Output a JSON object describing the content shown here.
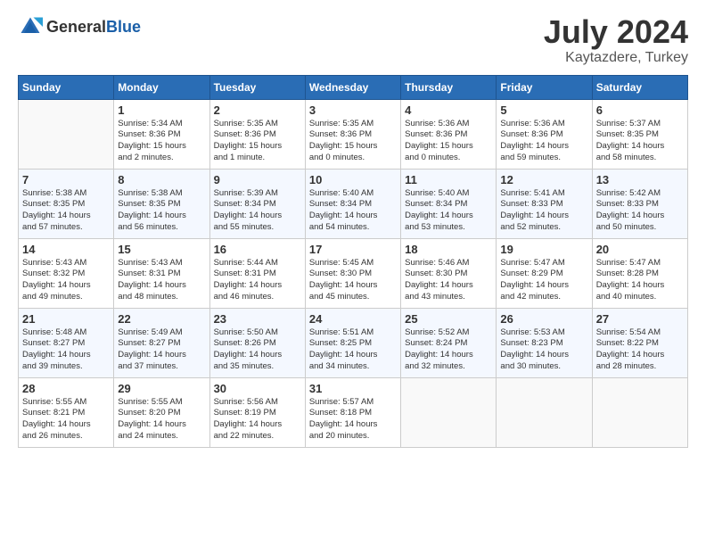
{
  "header": {
    "logo_general": "General",
    "logo_blue": "Blue",
    "month": "July 2024",
    "location": "Kaytazdere, Turkey"
  },
  "days_of_week": [
    "Sunday",
    "Monday",
    "Tuesday",
    "Wednesday",
    "Thursday",
    "Friday",
    "Saturday"
  ],
  "weeks": [
    [
      {
        "day": "",
        "info": ""
      },
      {
        "day": "1",
        "info": "Sunrise: 5:34 AM\nSunset: 8:36 PM\nDaylight: 15 hours\nand 2 minutes."
      },
      {
        "day": "2",
        "info": "Sunrise: 5:35 AM\nSunset: 8:36 PM\nDaylight: 15 hours\nand 1 minute."
      },
      {
        "day": "3",
        "info": "Sunrise: 5:35 AM\nSunset: 8:36 PM\nDaylight: 15 hours\nand 0 minutes."
      },
      {
        "day": "4",
        "info": "Sunrise: 5:36 AM\nSunset: 8:36 PM\nDaylight: 15 hours\nand 0 minutes."
      },
      {
        "day": "5",
        "info": "Sunrise: 5:36 AM\nSunset: 8:36 PM\nDaylight: 14 hours\nand 59 minutes."
      },
      {
        "day": "6",
        "info": "Sunrise: 5:37 AM\nSunset: 8:35 PM\nDaylight: 14 hours\nand 58 minutes."
      }
    ],
    [
      {
        "day": "7",
        "info": "Sunrise: 5:38 AM\nSunset: 8:35 PM\nDaylight: 14 hours\nand 57 minutes."
      },
      {
        "day": "8",
        "info": "Sunrise: 5:38 AM\nSunset: 8:35 PM\nDaylight: 14 hours\nand 56 minutes."
      },
      {
        "day": "9",
        "info": "Sunrise: 5:39 AM\nSunset: 8:34 PM\nDaylight: 14 hours\nand 55 minutes."
      },
      {
        "day": "10",
        "info": "Sunrise: 5:40 AM\nSunset: 8:34 PM\nDaylight: 14 hours\nand 54 minutes."
      },
      {
        "day": "11",
        "info": "Sunrise: 5:40 AM\nSunset: 8:34 PM\nDaylight: 14 hours\nand 53 minutes."
      },
      {
        "day": "12",
        "info": "Sunrise: 5:41 AM\nSunset: 8:33 PM\nDaylight: 14 hours\nand 52 minutes."
      },
      {
        "day": "13",
        "info": "Sunrise: 5:42 AM\nSunset: 8:33 PM\nDaylight: 14 hours\nand 50 minutes."
      }
    ],
    [
      {
        "day": "14",
        "info": "Sunrise: 5:43 AM\nSunset: 8:32 PM\nDaylight: 14 hours\nand 49 minutes."
      },
      {
        "day": "15",
        "info": "Sunrise: 5:43 AM\nSunset: 8:31 PM\nDaylight: 14 hours\nand 48 minutes."
      },
      {
        "day": "16",
        "info": "Sunrise: 5:44 AM\nSunset: 8:31 PM\nDaylight: 14 hours\nand 46 minutes."
      },
      {
        "day": "17",
        "info": "Sunrise: 5:45 AM\nSunset: 8:30 PM\nDaylight: 14 hours\nand 45 minutes."
      },
      {
        "day": "18",
        "info": "Sunrise: 5:46 AM\nSunset: 8:30 PM\nDaylight: 14 hours\nand 43 minutes."
      },
      {
        "day": "19",
        "info": "Sunrise: 5:47 AM\nSunset: 8:29 PM\nDaylight: 14 hours\nand 42 minutes."
      },
      {
        "day": "20",
        "info": "Sunrise: 5:47 AM\nSunset: 8:28 PM\nDaylight: 14 hours\nand 40 minutes."
      }
    ],
    [
      {
        "day": "21",
        "info": "Sunrise: 5:48 AM\nSunset: 8:27 PM\nDaylight: 14 hours\nand 39 minutes."
      },
      {
        "day": "22",
        "info": "Sunrise: 5:49 AM\nSunset: 8:27 PM\nDaylight: 14 hours\nand 37 minutes."
      },
      {
        "day": "23",
        "info": "Sunrise: 5:50 AM\nSunset: 8:26 PM\nDaylight: 14 hours\nand 35 minutes."
      },
      {
        "day": "24",
        "info": "Sunrise: 5:51 AM\nSunset: 8:25 PM\nDaylight: 14 hours\nand 34 minutes."
      },
      {
        "day": "25",
        "info": "Sunrise: 5:52 AM\nSunset: 8:24 PM\nDaylight: 14 hours\nand 32 minutes."
      },
      {
        "day": "26",
        "info": "Sunrise: 5:53 AM\nSunset: 8:23 PM\nDaylight: 14 hours\nand 30 minutes."
      },
      {
        "day": "27",
        "info": "Sunrise: 5:54 AM\nSunset: 8:22 PM\nDaylight: 14 hours\nand 28 minutes."
      }
    ],
    [
      {
        "day": "28",
        "info": "Sunrise: 5:55 AM\nSunset: 8:21 PM\nDaylight: 14 hours\nand 26 minutes."
      },
      {
        "day": "29",
        "info": "Sunrise: 5:55 AM\nSunset: 8:20 PM\nDaylight: 14 hours\nand 24 minutes."
      },
      {
        "day": "30",
        "info": "Sunrise: 5:56 AM\nSunset: 8:19 PM\nDaylight: 14 hours\nand 22 minutes."
      },
      {
        "day": "31",
        "info": "Sunrise: 5:57 AM\nSunset: 8:18 PM\nDaylight: 14 hours\nand 20 minutes."
      },
      {
        "day": "",
        "info": ""
      },
      {
        "day": "",
        "info": ""
      },
      {
        "day": "",
        "info": ""
      }
    ]
  ]
}
